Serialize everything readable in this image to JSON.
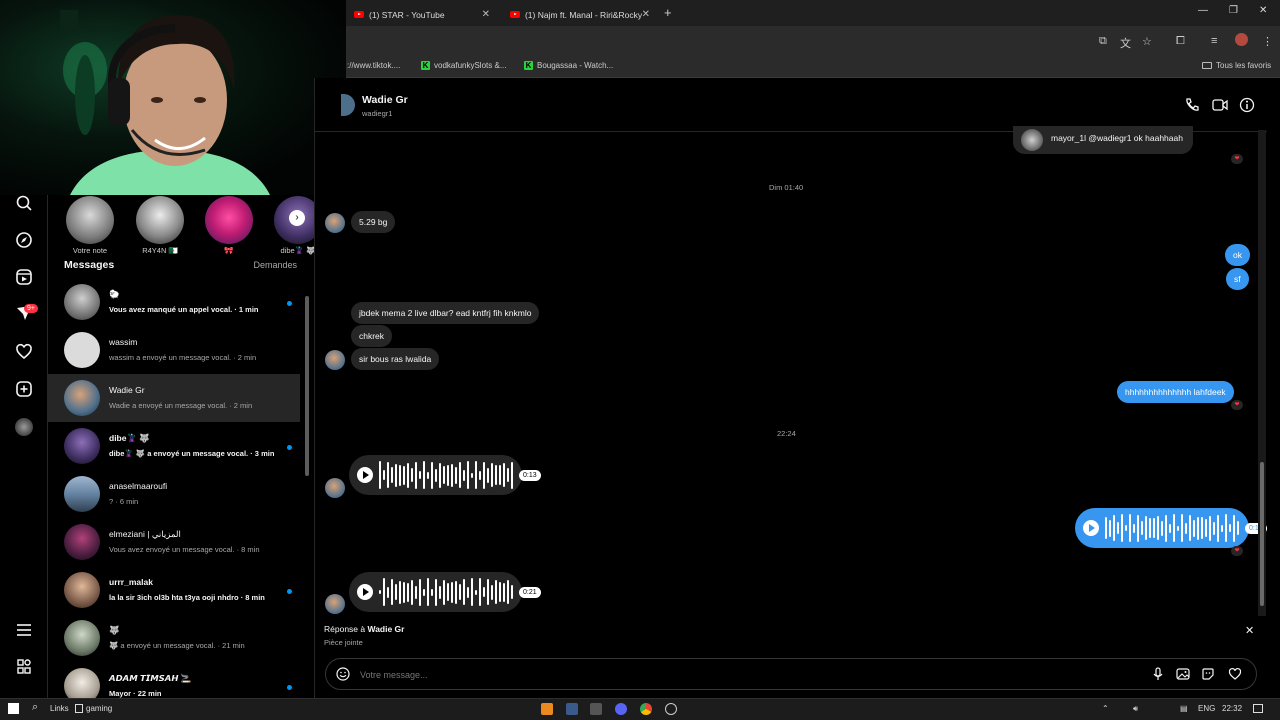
{
  "browser": {
    "tabs": [
      {
        "title": "(1) STAR - YouTube"
      },
      {
        "title": "(1) Najm ft. Manal - Riri&Rocky"
      }
    ],
    "new_tab": "+",
    "window_controls": {
      "minimize": "—",
      "restore": "❐",
      "close": "✕"
    },
    "url_fragment": "://www.tiktok....",
    "bookmarks": [
      {
        "label": "vodkafunkySlots &..."
      },
      {
        "label": "Bougassaa - Watch..."
      }
    ],
    "bookmarks_folder": "Tous les favoris"
  },
  "notes": [
    {
      "label": "Votre note"
    },
    {
      "label": "R4Y4N 🇩🇿"
    },
    {
      "label": "🎀"
    },
    {
      "label": "dibe🦹 🐺"
    }
  ],
  "inbox": {
    "title": "Messages",
    "requests": "Demandes",
    "notif_count": "9+",
    "conversations": [
      {
        "name": "🐑",
        "preview": "Vous avez manqué un appel vocal. · 1 min",
        "unread": true
      },
      {
        "name": "wassim",
        "preview": "wassim a envoyé un message vocal. · 2 min",
        "unread": false
      },
      {
        "name": "Wadie Gr",
        "preview": "Wadie a envoyé un message vocal. · 2 min",
        "unread": false
      },
      {
        "name": "dibe🦹 🐺",
        "preview": "dibe🦹 🐺 a envoyé un message vocal. · 3 min",
        "unread": true
      },
      {
        "name": "anaselmaaroufi",
        "preview": "? · 6 min",
        "unread": false
      },
      {
        "name": "elmeziani | المزياني",
        "preview": "Vous avez envoyé un message vocal. · 8 min",
        "unread": false
      },
      {
        "name": "urrr_malak",
        "preview": "la la sir 3ich ol3b hta t3ya ooji nhdro · 8 min",
        "unread": true
      },
      {
        "name": "🐺",
        "preview": "🐺 a envoyé un message vocal. · 21 min",
        "unread": false
      },
      {
        "name": "𝘼𝘿𝘼𝙈 𝙏𝙄𝙈𝙎𝘼𝙃 🚬",
        "preview": "Mayor · 22 min",
        "unread": true
      }
    ]
  },
  "chat": {
    "contact_name": "Wadie Gr",
    "contact_handle": "wadiegr1",
    "shared_post": "mayor_1l @wadiegr1 ok haahhaah",
    "stamp1": "Dim 01:40",
    "stamp2": "22:24",
    "messages": {
      "m1": "5.29 bg",
      "m2": "ok",
      "m3": "sf",
      "m4": "jbdek mema 2 live dlbar? ead kntfrj fih knkmlo",
      "m5": "chkrek",
      "m6": "sir bous ras lwalida",
      "m7": "hhhhhhhhhhhhhh lahfdeek"
    },
    "voice": {
      "v1": "0:13",
      "v2": "0:17",
      "v3": "0:21"
    },
    "reply_prefix": "Réponse à ",
    "reply_name": "Wadie Gr",
    "reply_attachment": "Pièce jointe",
    "composer_placeholder": "Votre message..."
  },
  "taskbar": {
    "links": "Links",
    "app": "gaming",
    "lang": "ENG",
    "time": "22:32"
  },
  "colors": {
    "accent": "#3797f0",
    "unread_dot": "#0095f6",
    "badge": "#ff3040"
  }
}
